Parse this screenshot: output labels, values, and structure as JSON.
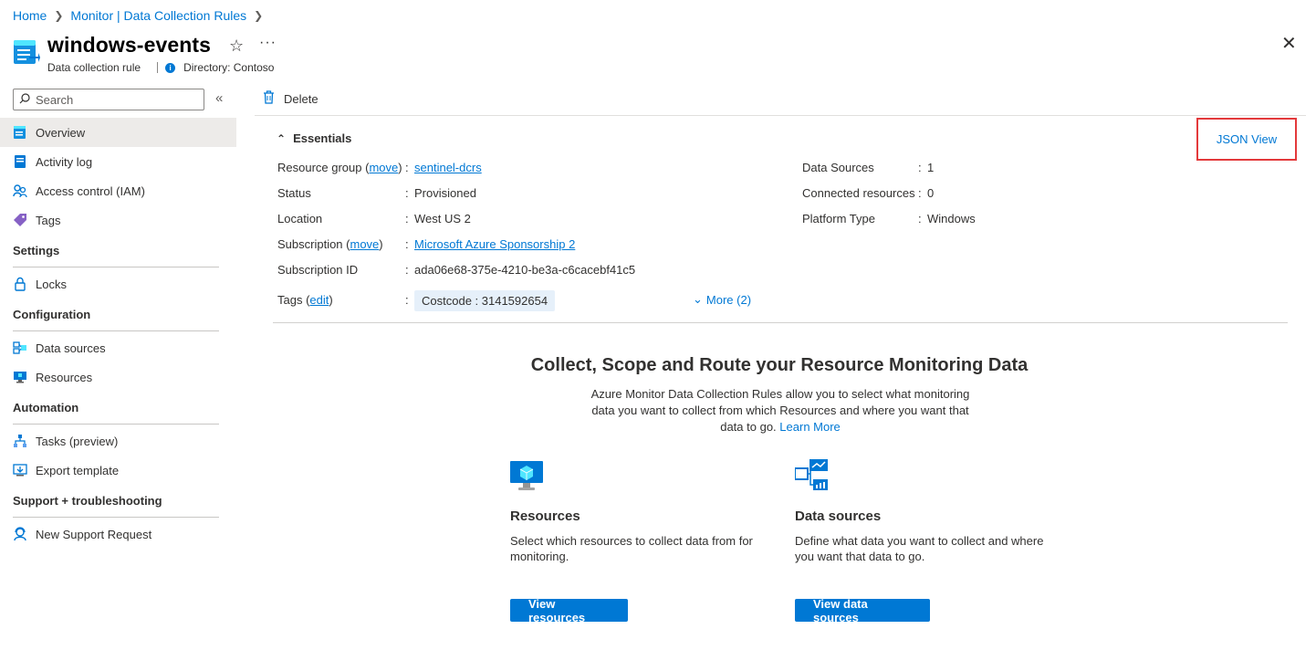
{
  "breadcrumb": [
    {
      "label": "Home"
    },
    {
      "label": "Monitor | Data Collection Rules"
    }
  ],
  "header": {
    "title": "windows-events",
    "type_label": "Data collection rule",
    "directory": "Directory: Contoso",
    "favorite_icon": "star-icon",
    "more_icon": "ellipsis-icon",
    "close_icon": "close-icon"
  },
  "sidebar": {
    "search_placeholder": "Search",
    "top_items": [
      {
        "label": "Overview",
        "icon": "overview-icon",
        "active": true
      },
      {
        "label": "Activity log",
        "icon": "activity-log-icon"
      },
      {
        "label": "Access control (IAM)",
        "icon": "iam-icon"
      },
      {
        "label": "Tags",
        "icon": "tag-icon"
      }
    ],
    "sections": [
      {
        "title": "Settings",
        "items": [
          {
            "label": "Locks",
            "icon": "lock-icon"
          }
        ]
      },
      {
        "title": "Configuration",
        "items": [
          {
            "label": "Data sources",
            "icon": "data-sources-icon"
          },
          {
            "label": "Resources",
            "icon": "resources-icon"
          }
        ]
      },
      {
        "title": "Automation",
        "items": [
          {
            "label": "Tasks (preview)",
            "icon": "tasks-icon"
          },
          {
            "label": "Export template",
            "icon": "export-template-icon"
          }
        ]
      },
      {
        "title": "Support + troubleshooting",
        "items": [
          {
            "label": "New Support Request",
            "icon": "support-icon"
          }
        ]
      }
    ]
  },
  "toolbar": {
    "delete_label": "Delete"
  },
  "essentials": {
    "title": "Essentials",
    "json_view": "JSON View",
    "left": {
      "resource_group_label": "Resource group",
      "move": "move",
      "resource_group_value": "sentinel-dcrs",
      "status_label": "Status",
      "status_value": "Provisioned",
      "location_label": "Location",
      "location_value": "West US 2",
      "subscription_label": "Subscription",
      "subscription_value": "Microsoft Azure Sponsorship 2",
      "subscription_id_label": "Subscription ID",
      "subscription_id_value": "ada06e68-375e-4210-be3a-c6cacebf41c5",
      "tags_label": "Tags",
      "edit": "edit",
      "tag_value": "Costcode : 3141592654",
      "more_tags": "More (2)"
    },
    "right": {
      "data_sources_label": "Data Sources",
      "data_sources_value": "1",
      "connected_label": "Connected resources",
      "connected_value": "0",
      "platform_label": "Platform Type",
      "platform_value": "Windows"
    }
  },
  "collect": {
    "title": "Collect, Scope and Route your Resource Monitoring Data",
    "description": "Azure Monitor Data Collection Rules allow you to select what monitoring data you want to collect from which Resources and where you want that data to go.",
    "learn_more": "Learn More",
    "cards": [
      {
        "title": "Resources",
        "description": "Select which resources to collect data from for monitoring.",
        "button": "View resources",
        "icon": "resources-monitor-icon"
      },
      {
        "title": "Data sources",
        "description": "Define what data you want to collect and where you want that data to go.",
        "button": "View data sources",
        "icon": "data-sources-flow-icon"
      }
    ]
  }
}
